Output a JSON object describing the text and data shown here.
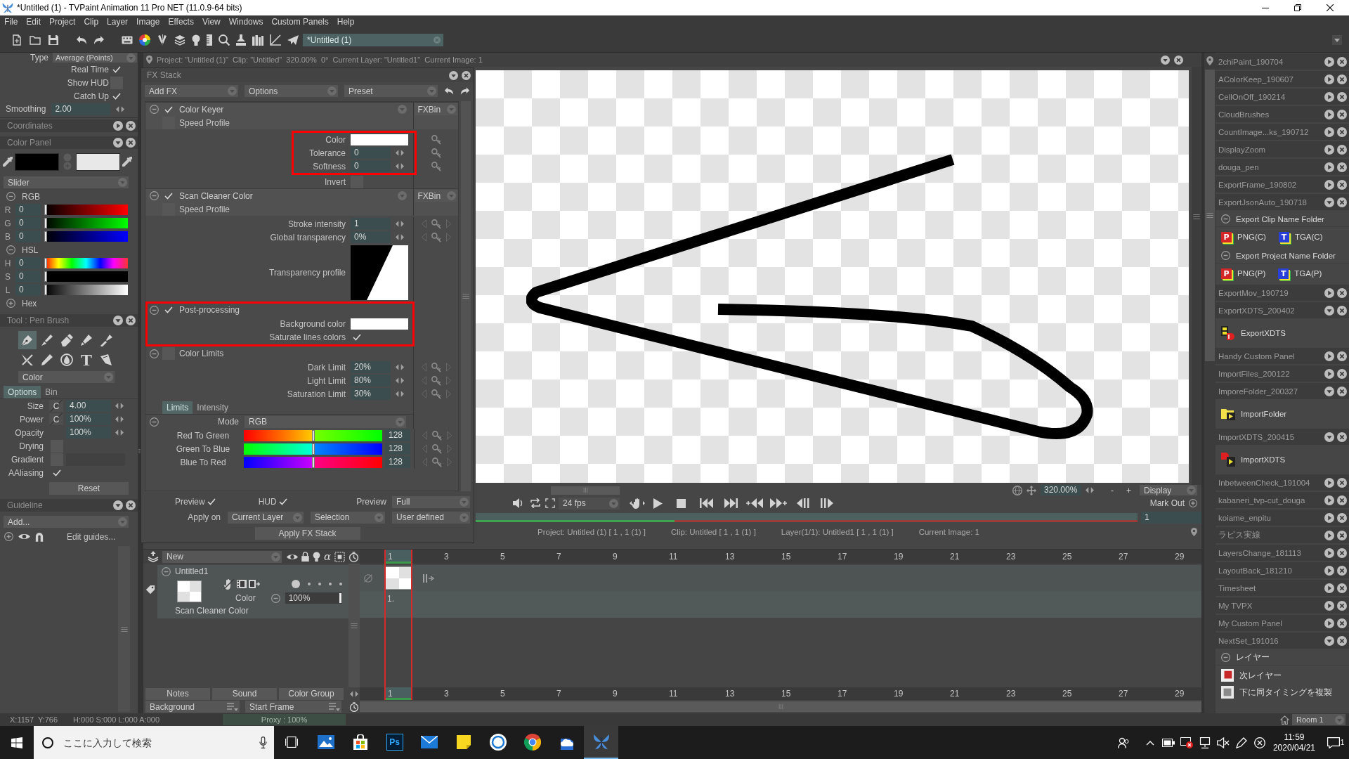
{
  "window": {
    "title": "*Untitled (1) - TVPaint Animation 11 Pro NET (11.0.9-64 bits)"
  },
  "menu": [
    "File",
    "Edit",
    "Project",
    "Clip",
    "Layer",
    "Image",
    "Effects",
    "View",
    "Windows",
    "Custom Panels",
    "Help"
  ],
  "toolbar": {
    "document_tab": "*Untitled (1)"
  },
  "left_panel": {
    "stroke_options": {
      "type": {
        "label": "Type",
        "value": "Average (Points)"
      },
      "toggles": [
        {
          "label": "Real Time",
          "checked": true
        },
        {
          "label": "Show HUD",
          "checked": false
        },
        {
          "label": "Catch Up",
          "checked": true
        }
      ],
      "smoothing": {
        "label": "Smoothing",
        "value": "2.00"
      }
    },
    "coordinates_panel": {
      "title": "Coordinates",
      "expanded": false
    },
    "color_panel": {
      "title": "Color Panel",
      "expanded": true,
      "swatches": [
        {
          "color": "#000000"
        },
        {
          "color": "#e8e8e8"
        }
      ],
      "mode": "Slider",
      "groups": [
        {
          "label": "RGB",
          "expanded": true,
          "channels": [
            {
              "kind": "red",
              "label": "R",
              "value": "0",
              "level": 0
            },
            {
              "kind": "green",
              "label": "G",
              "value": "0",
              "level": 0
            },
            {
              "kind": "blue",
              "label": "B",
              "value": "0",
              "level": 0
            }
          ]
        },
        {
          "label": "HSL",
          "expanded": true,
          "channels": [
            {
              "kind": "hue",
              "label": "H",
              "value": "0",
              "level": 0
            },
            {
              "kind": "saturation",
              "label": "S",
              "value": "0",
              "level": 0
            },
            {
              "kind": "lightness",
              "label": "L",
              "value": "0",
              "level": 0
            }
          ]
        },
        {
          "label": "Hex",
          "expanded": false
        }
      ]
    },
    "tool_panel": {
      "title": "Tool : Pen Brush",
      "expanded": true,
      "tools": [
        {
          "kind": "pen",
          "selected": true
        },
        {
          "kind": "brush",
          "selected": false
        },
        {
          "kind": "eraser",
          "selected": false
        },
        {
          "kind": "marker",
          "selected": false
        },
        {
          "kind": "airbrush",
          "selected": false
        },
        {
          "kind": "cutter",
          "selected": false
        },
        {
          "kind": "pencil",
          "selected": false
        },
        {
          "kind": "drop",
          "selected": false
        },
        {
          "kind": "text",
          "selected": false,
          "glyph": "T"
        },
        {
          "kind": "cone",
          "selected": false
        }
      ],
      "preset": "Color",
      "tabs": [
        {
          "label": "Options",
          "selected": true
        },
        {
          "label": "Bin",
          "selected": false
        }
      ],
      "settings": [
        {
          "kind": "number",
          "label": "Size",
          "pressure": "C",
          "value": "4.00"
        },
        {
          "kind": "number",
          "label": "Power",
          "pressure": "C",
          "value": "100%"
        },
        {
          "kind": "number",
          "label": "Opacity",
          "value": "100%"
        },
        {
          "kind": "checkbox",
          "label": "Drying",
          "checked": false
        },
        {
          "kind": "gradient",
          "label": "Gradient",
          "checked": false
        },
        {
          "kind": "checkbox",
          "label": "AAliasing",
          "checked": true
        }
      ],
      "reset": "Reset"
    },
    "guideline_panel": {
      "title": "Guideline",
      "expanded": true,
      "add": "Add...",
      "edit": "Edit guides..."
    }
  },
  "fx_stack": {
    "title": "FX Stack",
    "toolbar": [
      "Add FX",
      "Options",
      "Preset"
    ],
    "effects": [
      {
        "name": "Color Keyer",
        "enabled": true,
        "expanded": true,
        "bin": "FXBin",
        "speed_profile": {
          "label": "Speed Profile",
          "checked": false
        },
        "params": [
          {
            "kind": "color",
            "label": "Color",
            "color": "#ffffff",
            "animatable": true,
            "key_nav": false,
            "highlighted": true
          },
          {
            "kind": "number",
            "label": "Tolerance",
            "value": "0",
            "animatable": true,
            "key_nav": false,
            "highlighted": true
          },
          {
            "kind": "number",
            "label": "Softness",
            "value": "0",
            "animatable": true,
            "key_nav": false,
            "highlighted": true
          },
          {
            "kind": "checkbox",
            "label": "Invert",
            "checked": false,
            "animatable": false,
            "key_nav": false,
            "highlighted": false
          }
        ]
      },
      {
        "name": "Scan Cleaner Color",
        "enabled": true,
        "expanded": true,
        "bin": "FXBin",
        "speed_profile": {
          "label": "Speed Profile",
          "checked": false
        },
        "params": [
          {
            "kind": "number",
            "label": "Stroke intensity",
            "value": "1",
            "animatable": true,
            "key_nav": true,
            "highlighted": false
          },
          {
            "kind": "number",
            "label": "Global transparency",
            "value": "0%",
            "animatable": true,
            "key_nav": true,
            "highlighted": false
          },
          {
            "kind": "curve",
            "label": "Transparency profile",
            "animatable": false,
            "key_nav": false,
            "highlighted": false
          }
        ],
        "sections": [
          {
            "name": "Post-processing",
            "enabled": true,
            "expanded": true,
            "highlighted": true,
            "params": [
              {
                "kind": "color",
                "label": "Background color",
                "color": "#ffffff",
                "animatable": false,
                "key_nav": false,
                "highlighted": false
              },
              {
                "kind": "checkbox",
                "label": "Saturate lines colors",
                "checked": true,
                "animatable": false,
                "key_nav": false,
                "highlighted": false
              }
            ]
          },
          {
            "name": "Color Limits",
            "enabled": false,
            "expanded": true,
            "highlighted": false,
            "params": [
              {
                "kind": "number",
                "label": "Dark Limit",
                "value": "20%",
                "animatable": true,
                "key_nav": true,
                "highlighted": false
              },
              {
                "kind": "number",
                "label": "Light Limit",
                "value": "80%",
                "animatable": true,
                "key_nav": true,
                "highlighted": false
              },
              {
                "kind": "number",
                "label": "Saturation Limit",
                "value": "30%",
                "animatable": true,
                "key_nav": true,
                "highlighted": false
              }
            ],
            "tabs": [
              {
                "label": "Limits",
                "selected": true
              },
              {
                "label": "Intensity",
                "selected": false
              }
            ],
            "mode": {
              "label": "Mode",
              "value": "RGB",
              "expanded": true
            },
            "ranges": [
              {
                "kind": "red-green",
                "label": "Red To Green",
                "level": 0.5,
                "value": "128",
                "animatable": true,
                "key_nav": true
              },
              {
                "kind": "green-blue",
                "label": "Green To Blue",
                "level": 0.5,
                "value": "128",
                "animatable": true,
                "key_nav": true
              },
              {
                "kind": "blue-red",
                "label": "Blue To Red",
                "level": 0.5,
                "value": "128",
                "animatable": true,
                "key_nav": true
              }
            ]
          }
        ]
      }
    ],
    "footer": {
      "preview": {
        "label": "Preview",
        "checked": true
      },
      "hud": {
        "label": "HUD",
        "checked": true
      },
      "preview_mode": {
        "label": "Preview",
        "value": "Full"
      },
      "apply_on": {
        "label": "Apply on",
        "options": [
          "Current Layer",
          "Selection",
          "User defined"
        ]
      },
      "apply": "Apply FX Stack"
    }
  },
  "canvas_panel": {
    "info": "Project: \"Untitled (1)\"  Clip: \"Untitled\"  320.00%  0°  Current Layer: \"Untitled1\"  Current Image: 1",
    "zoom": "320.00%",
    "zoom_out": "-",
    "zoom_in": "+",
    "display": "Display",
    "playback": {
      "fps": "24 fps",
      "mark_out": "Mark Out"
    },
    "range": {
      "level": 0.3,
      "value": "1"
    },
    "status": [
      "Project: Untitled (1) [ 1 , 1 (1) ]",
      "Clip: Untitled [ 1 , 1 (1) ]",
      "Layer(1/1): Untitled1 [ 1 , 1 (1) ]",
      "Current Image: 1"
    ]
  },
  "timeline": {
    "layer_menu": "New",
    "alpha_glyph": "α",
    "layers": [
      {
        "name": "Untitled1",
        "expanded": true,
        "selected": true,
        "blend_mode": "Color",
        "opacity": {
          "value": "100%",
          "level": 1
        },
        "dots": [
          {
            "on": true
          },
          {
            "on": false
          },
          {
            "on": false
          },
          {
            "on": false
          },
          {
            "on": false
          }
        ],
        "effect": "Scan Cleaner Color",
        "frames": [
          {
            "label": "1."
          }
        ]
      }
    ],
    "ruler_top": [
      {
        "label": "1",
        "selected": true
      },
      {
        "label": "3",
        "selected": false
      },
      {
        "label": "5",
        "selected": false
      },
      {
        "label": "7",
        "selected": false
      },
      {
        "label": "9",
        "selected": false
      },
      {
        "label": "11",
        "selected": false
      },
      {
        "label": "13",
        "selected": false
      },
      {
        "label": "15",
        "selected": false
      },
      {
        "label": "17",
        "selected": false
      },
      {
        "label": "19",
        "selected": false
      },
      {
        "label": "21",
        "selected": false
      },
      {
        "label": "23",
        "selected": false
      },
      {
        "label": "25",
        "selected": false
      },
      {
        "label": "27",
        "selected": false
      },
      {
        "label": "29",
        "selected": false
      }
    ],
    "ruler_bottom": [
      {
        "label": "1",
        "selected": true
      },
      {
        "label": "3",
        "selected": false
      },
      {
        "label": "5",
        "selected": false
      },
      {
        "label": "7",
        "selected": false
      },
      {
        "label": "9",
        "selected": false
      },
      {
        "label": "11",
        "selected": false
      },
      {
        "label": "13",
        "selected": false
      },
      {
        "label": "15",
        "selected": false
      },
      {
        "label": "17",
        "selected": false
      },
      {
        "label": "19",
        "selected": false
      },
      {
        "label": "21",
        "selected": false
      },
      {
        "label": "23",
        "selected": false
      },
      {
        "label": "25",
        "selected": false
      },
      {
        "label": "27",
        "selected": false
      },
      {
        "label": "29",
        "selected": false
      }
    ],
    "buttons": [
      "Notes",
      "Sound",
      "Color Group"
    ],
    "background": "Background",
    "start_frame": "Start Frame"
  },
  "custom_panels": {
    "items": [
      {
        "name": "2chiPaint_190704",
        "expanded": false
      },
      {
        "name": "AColorKeep_190607",
        "expanded": false
      },
      {
        "name": "CellOnOff_190214",
        "expanded": false
      },
      {
        "name": "CloudBrushes",
        "expanded": false
      },
      {
        "name": "CountImage...ks_190712",
        "expanded": false
      },
      {
        "name": "DisplayZoom",
        "expanded": false
      },
      {
        "name": "douga_pen",
        "expanded": false
      },
      {
        "name": "ExportFrame_190802",
        "expanded": false
      },
      {
        "name": "ExportJsonAuto_190718",
        "expanded": true,
        "groups": [
          {
            "label": "Export Clip Name Folder",
            "expanded": true,
            "buttons": [
              {
                "kind": "png",
                "glyph": "P",
                "label": "PNG(C)"
              },
              {
                "kind": "tga",
                "glyph": "T",
                "label": "TGA(C)"
              }
            ]
          },
          {
            "label": "Export Project Name Folder",
            "expanded": true,
            "buttons": [
              {
                "kind": "png",
                "glyph": "P",
                "label": "PNG(P)"
              },
              {
                "kind": "tga",
                "glyph": "T",
                "label": "TGA(P)"
              }
            ]
          }
        ]
      },
      {
        "name": "ExportMov_190719",
        "expanded": false
      },
      {
        "name": "ExportXDTS_200402",
        "expanded": true,
        "buttons": [
          {
            "kind": "export-xdts",
            "label": "ExportXDTS"
          }
        ]
      },
      {
        "name": "Handy Custom Panel",
        "expanded": false
      },
      {
        "name": "ImportFiles_200122",
        "expanded": false
      },
      {
        "name": "ImporeFolder_200327",
        "expanded": true,
        "buttons": [
          {
            "kind": "import-folder",
            "label": "ImportFolder"
          }
        ]
      },
      {
        "name": "ImportXDTS_200415",
        "expanded": true,
        "buttons": [
          {
            "kind": "import-xdts",
            "label": "ImportXDTS"
          }
        ]
      },
      {
        "name": "InbetweenCheck_191004",
        "expanded": false
      },
      {
        "name": "kabaneri_tvp-cut_douga",
        "expanded": false
      },
      {
        "name": "koiame_enpitu",
        "expanded": false
      },
      {
        "name": "ラピス実線",
        "expanded": false
      },
      {
        "name": "LayersChange_181113",
        "expanded": false
      },
      {
        "name": "LayoutBack_181210",
        "expanded": false
      },
      {
        "name": "Timesheet",
        "expanded": false
      },
      {
        "name": "My TVPX",
        "expanded": false
      },
      {
        "name": "My Custom Panel",
        "expanded": false
      },
      {
        "name": "NextSet_191016",
        "expanded": true,
        "groups": [
          {
            "label": "レイヤー",
            "expanded": true,
            "buttons": [
              {
                "kind": "layer-next",
                "label": "次レイヤー"
              },
              {
                "kind": "layer-copy",
                "label": "下に同タイミングを複製"
              }
            ]
          }
        ]
      }
    ]
  },
  "status_bar": {
    "cursor": "X:1157  Y:766",
    "hsla_readout": "H:000 S:000 L:000 A:000",
    "proxy": "Proxy : 100%",
    "room": "Room 1"
  },
  "taskbar": {
    "search_placeholder": "ここに入力して検索",
    "apps": [
      {
        "kind": "task-view",
        "active": false
      },
      {
        "kind": "photos",
        "active": false
      },
      {
        "kind": "store",
        "active": false
      },
      {
        "kind": "photoshop",
        "glyph": "Ps",
        "active": false
      },
      {
        "kind": "mail",
        "active": false
      },
      {
        "kind": "sticky-notes",
        "active": false
      },
      {
        "kind": "ring-app",
        "active": false
      },
      {
        "kind": "browser",
        "active": false
      },
      {
        "kind": "cloud-app",
        "active": false
      },
      {
        "kind": "butterfly",
        "active": true
      }
    ],
    "time": "11:59",
    "date": "2020/04/21",
    "notifications": "1"
  }
}
